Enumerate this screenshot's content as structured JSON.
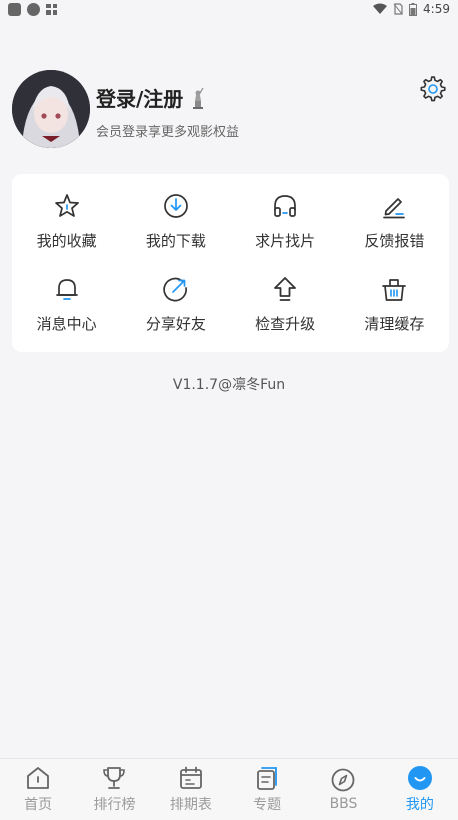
{
  "status_bar": {
    "time": "4:59"
  },
  "profile": {
    "title": "登录/注册",
    "subtitle": "会员登录享更多观影权益"
  },
  "menu": {
    "items": [
      {
        "label": "我的收藏",
        "icon": "star-icon"
      },
      {
        "label": "我的下载",
        "icon": "download-icon"
      },
      {
        "label": "求片找片",
        "icon": "headphones-icon"
      },
      {
        "label": "反馈报错",
        "icon": "edit-icon"
      },
      {
        "label": "消息中心",
        "icon": "bell-icon"
      },
      {
        "label": "分享好友",
        "icon": "share-icon"
      },
      {
        "label": "检查升级",
        "icon": "upgrade-icon"
      },
      {
        "label": "清理缓存",
        "icon": "basket-icon"
      }
    ]
  },
  "version": "V1.1.7@凛冬Fun",
  "tabs": [
    {
      "label": "首页",
      "icon": "home-icon"
    },
    {
      "label": "排行榜",
      "icon": "trophy-icon"
    },
    {
      "label": "排期表",
      "icon": "calendar-icon"
    },
    {
      "label": "专题",
      "icon": "topic-icon"
    },
    {
      "label": "BBS",
      "icon": "compass-icon"
    },
    {
      "label": "我的",
      "icon": "profile-icon",
      "active": true
    }
  ],
  "colors": {
    "accent": "#2196f3",
    "inactive": "#9a9a9a"
  }
}
